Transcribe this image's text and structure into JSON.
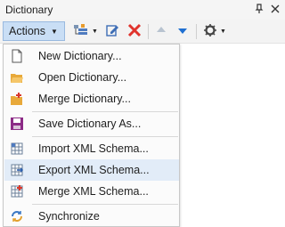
{
  "panel": {
    "title": "Dictionary",
    "pin_glyph": "†",
    "close_glyph": "✕"
  },
  "toolbar": {
    "actions_label": "Actions",
    "icons": [
      "add-item-icon",
      "edit-icon",
      "delete-icon",
      "move-up-icon",
      "move-down-icon",
      "settings-icon"
    ]
  },
  "menu": {
    "items": [
      {
        "label": "New Dictionary...",
        "icon": "new-document-icon"
      },
      {
        "label": "Open Dictionary...",
        "icon": "open-folder-icon"
      },
      {
        "label": "Merge Dictionary...",
        "icon": "merge-folder-icon"
      },
      {
        "label": "Save Dictionary As...",
        "icon": "save-icon"
      },
      {
        "label": "Import XML Schema...",
        "icon": "import-schema-icon"
      },
      {
        "label": "Export XML Schema...",
        "icon": "export-schema-icon"
      },
      {
        "label": "Merge XML Schema...",
        "icon": "merge-schema-icon"
      },
      {
        "label": "Synchronize",
        "icon": "synchronize-icon"
      }
    ],
    "highlighted_index": 5
  },
  "colors": {
    "accent": "#c9def5",
    "hover": "#e2ecf8",
    "delete": "#e0332c",
    "arrow": "#1f6fd1",
    "save": "#8c2b86"
  }
}
